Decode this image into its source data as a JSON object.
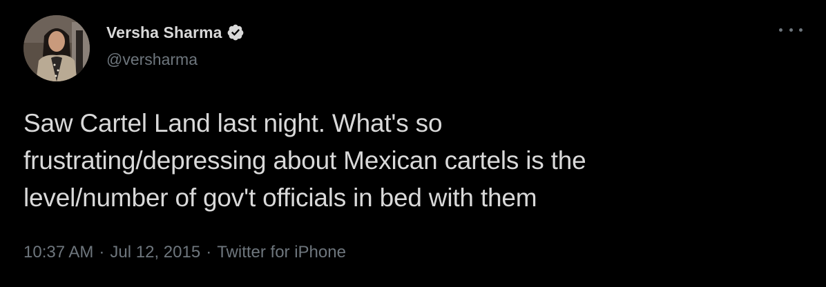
{
  "user": {
    "display_name": "Versha Sharma",
    "handle": "@versharma",
    "verified": true,
    "avatar_icon": "profile-photo"
  },
  "tweet": {
    "lines": [
      "Saw Cartel Land last night. What's so",
      "frustrating/depressing about Mexican cartels is the",
      "level/number of gov't officials in bed with them"
    ]
  },
  "meta": {
    "time": "10:37 AM",
    "date": "Jul 12, 2015",
    "separator": "·",
    "client": "Twitter for iPhone"
  },
  "icons": {
    "more": "more-options-icon",
    "verified": "verified-badge-icon"
  },
  "colors": {
    "background": "#000000",
    "primary_text": "#d9d9d9",
    "secondary_text": "#6e767d",
    "verified_badge": "#d9d9d9"
  }
}
